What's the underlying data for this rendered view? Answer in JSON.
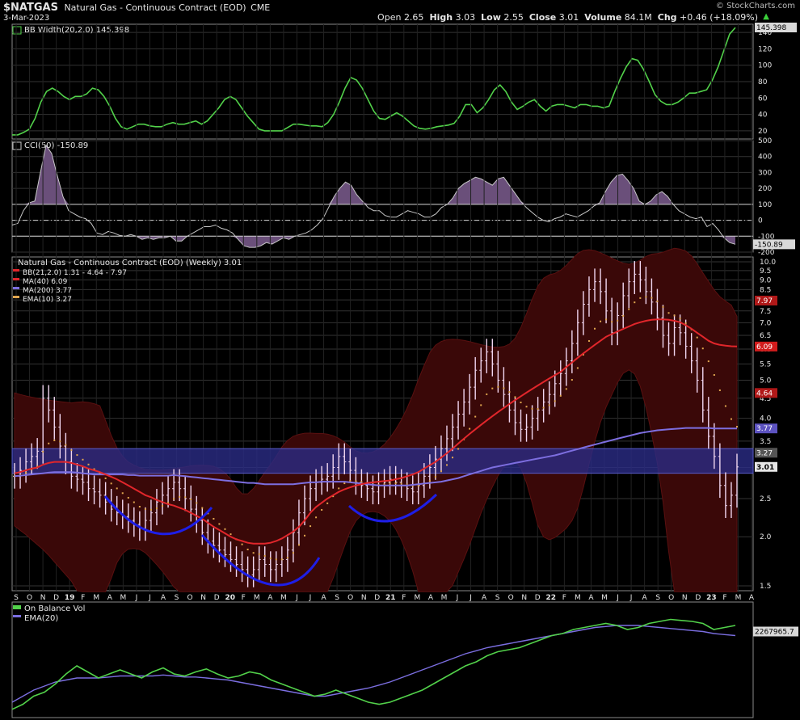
{
  "header": {
    "symbol": "$NATGAS",
    "description": "Natural Gas - Continuous Contract (EOD)",
    "exchange": "CME",
    "date": "3-Mar-2023",
    "watermark": "© StockCharts.com",
    "open_label": "Open",
    "open": "2.65",
    "high_label": "High",
    "high": "3.03",
    "low_label": "Low",
    "low": "2.55",
    "close_label": "Close",
    "close": "3.01",
    "volume_label": "Volume",
    "volume": "84.1M",
    "chg_label": "Chg",
    "chg": "+0.46 (+18.09%)"
  },
  "colors": {
    "background": "#000000",
    "grid": "#333333",
    "bbwidth": "#52d14a",
    "cci_fill": "#6a4f7a",
    "ma40": "#e1262b",
    "ma200": "#7d6ee0",
    "ema10": "#e0a64f",
    "candle": "#f1d6f0",
    "bb_fill": "#3a0808",
    "support_band": "#2a2c86",
    "obv": "#52d14a",
    "obv_ema": "#7b6ee0",
    "pattern_arc": "#1e1ee6"
  },
  "chart_data": [
    {
      "type": "line",
      "panel": "BB Width",
      "title": "BB Width(20,2.0) 145.398",
      "last_value_label": "145.398",
      "y_ticks": [
        "20",
        "40",
        "60",
        "80",
        "100",
        "120",
        "140"
      ],
      "ylim": [
        10,
        150
      ],
      "series": [
        {
          "name": "BB Width(20,2.0)",
          "values": [
            15,
            15,
            18,
            22,
            35,
            55,
            68,
            72,
            68,
            62,
            58,
            62,
            62,
            65,
            72,
            70,
            62,
            50,
            35,
            25,
            22,
            25,
            28,
            28,
            26,
            25,
            25,
            28,
            30,
            28,
            28,
            30,
            32,
            28,
            32,
            40,
            48,
            58,
            62,
            58,
            48,
            38,
            30,
            22,
            20,
            20,
            20,
            20,
            24,
            28,
            28,
            27,
            26,
            26,
            25,
            30,
            40,
            55,
            72,
            85,
            82,
            72,
            58,
            44,
            35,
            34,
            38,
            42,
            38,
            32,
            26,
            23,
            22,
            23,
            25,
            26,
            27,
            29,
            38,
            52,
            52,
            42,
            48,
            58,
            70,
            76,
            68,
            55,
            46,
            50,
            55,
            58,
            50,
            44,
            50,
            52,
            52,
            50,
            48,
            52,
            52,
            50,
            50,
            48,
            50,
            68,
            84,
            98,
            108,
            106,
            95,
            80,
            64,
            56,
            52,
            52,
            55,
            60,
            66,
            66,
            68,
            70,
            82,
            98,
            118,
            138,
            146
          ]
        }
      ]
    },
    {
      "type": "area",
      "panel": "CCI",
      "title": "CCI(50) -150.89",
      "last_value_label": "-150.89",
      "y_ticks": [
        "500",
        "400",
        "300",
        "200",
        "100",
        "0",
        "-100",
        "-200"
      ],
      "ylim": [
        -200,
        500
      ],
      "series": [
        {
          "name": "CCI(50)",
          "values": [
            -30,
            -20,
            60,
            110,
            120,
            300,
            470,
            420,
            280,
            150,
            60,
            40,
            20,
            10,
            -20,
            -80,
            -90,
            -70,
            -80,
            -95,
            -100,
            -90,
            -100,
            -120,
            -110,
            -120,
            -110,
            -110,
            -100,
            -130,
            -130,
            -100,
            -80,
            -60,
            -40,
            -40,
            -30,
            -50,
            -60,
            -80,
            -120,
            -160,
            -170,
            -170,
            -160,
            -140,
            -150,
            -130,
            -110,
            -120,
            -100,
            -90,
            -80,
            -60,
            -30,
            10,
            80,
            150,
            200,
            240,
            220,
            160,
            120,
            80,
            60,
            60,
            30,
            20,
            20,
            40,
            60,
            50,
            40,
            20,
            20,
            40,
            80,
            100,
            140,
            200,
            230,
            250,
            270,
            260,
            240,
            220,
            260,
            270,
            220,
            170,
            120,
            80,
            50,
            20,
            0,
            -10,
            10,
            20,
            40,
            30,
            20,
            40,
            60,
            90,
            110,
            180,
            240,
            280,
            290,
            250,
            200,
            120,
            100,
            120,
            160,
            180,
            150,
            100,
            60,
            40,
            20,
            10,
            20,
            -40,
            -20,
            -60,
            -110,
            -140,
            -151
          ]
        }
      ]
    },
    {
      "type": "line",
      "panel": "Price",
      "title": "Natural Gas - Continuous Contract (EOD) (Weekly) 3.01",
      "legend": [
        {
          "name": "BB(21,2.0) 1.31 - 4.64 - 7.97"
        },
        {
          "name": "MA(40) 6.09"
        },
        {
          "name": "MA(200) 3.77"
        },
        {
          "name": "EMA(10) 3.27"
        }
      ],
      "y_ticks": [
        "1.5",
        "2.0",
        "2.5",
        "3.0",
        "3.5",
        "4.0",
        "4.5",
        "5.0",
        "5.5",
        "6.0",
        "6.5",
        "7.0",
        "7.5",
        "8.0",
        "8.5",
        "9.0",
        "9.5",
        "10.0"
      ],
      "ylim": [
        1.5,
        10.0
      ],
      "value_labels": [
        "7.97",
        "6.09",
        "4.64",
        "3.77",
        "3.27",
        "3.01"
      ],
      "x_ticks": [
        "S",
        "O",
        "N",
        "D",
        "19",
        "F",
        "M",
        "A",
        "M",
        "J",
        "J",
        "A",
        "S",
        "O",
        "N",
        "D",
        "20",
        "F",
        "M",
        "A",
        "M",
        "J",
        "J",
        "A",
        "S",
        "O",
        "N",
        "D",
        "21",
        "F",
        "M",
        "A",
        "M",
        "J",
        "J",
        "A",
        "S",
        "O",
        "N",
        "D",
        "22",
        "F",
        "M",
        "A",
        "M",
        "J",
        "J",
        "A",
        "S",
        "O",
        "N",
        "D",
        "23",
        "F",
        "M",
        "A"
      ],
      "close": [
        2.85,
        2.95,
        3.1,
        3.2,
        3.3,
        4.5,
        4.2,
        3.8,
        3.4,
        3.1,
        2.85,
        2.8,
        2.75,
        2.65,
        2.6,
        2.55,
        2.45,
        2.35,
        2.3,
        2.25,
        2.2,
        2.15,
        2.1,
        2.2,
        2.3,
        2.45,
        2.55,
        2.65,
        2.75,
        2.65,
        2.5,
        2.35,
        2.2,
        2.05,
        1.95,
        1.9,
        1.85,
        1.8,
        1.75,
        1.7,
        1.65,
        1.6,
        1.65,
        1.75,
        1.7,
        1.65,
        1.7,
        1.75,
        1.85,
        2.05,
        2.3,
        2.5,
        2.65,
        2.75,
        2.8,
        2.85,
        3.0,
        3.2,
        3.1,
        2.95,
        2.75,
        2.7,
        2.65,
        2.6,
        2.7,
        2.75,
        2.8,
        2.75,
        2.7,
        2.65,
        2.6,
        2.7,
        2.85,
        3.0,
        3.15,
        3.35,
        3.55,
        3.8,
        4.1,
        4.4,
        4.8,
        5.3,
        5.6,
        5.9,
        5.5,
        5.0,
        4.6,
        4.2,
        3.9,
        3.75,
        3.8,
        4.0,
        4.2,
        4.4,
        4.6,
        4.9,
        5.2,
        5.6,
        6.2,
        7.0,
        7.8,
        8.5,
        8.9,
        8.4,
        7.5,
        6.6,
        7.3,
        8.2,
        8.9,
        9.3,
        9.0,
        8.4,
        7.9,
        7.2,
        6.5,
        6.2,
        6.8,
        6.6,
        6.1,
        5.6,
        5.0,
        4.2,
        3.6,
        3.2,
        2.7,
        2.4,
        2.55,
        3.01
      ],
      "ma40": [
        2.9,
        2.92,
        2.95,
        2.98,
        3.0,
        3.05,
        3.08,
        3.1,
        3.1,
        3.1,
        3.08,
        3.05,
        3.02,
        2.98,
        2.95,
        2.92,
        2.88,
        2.84,
        2.8,
        2.75,
        2.7,
        2.65,
        2.6,
        2.55,
        2.52,
        2.48,
        2.45,
        2.42,
        2.4,
        2.37,
        2.34,
        2.3,
        2.26,
        2.22,
        2.17,
        2.12,
        2.08,
        2.04,
        2.0,
        1.97,
        1.95,
        1.93,
        1.92,
        1.92,
        1.92,
        1.93,
        1.95,
        1.98,
        2.02,
        2.06,
        2.12,
        2.2,
        2.3,
        2.38,
        2.44,
        2.5,
        2.55,
        2.6,
        2.64,
        2.67,
        2.7,
        2.72,
        2.74,
        2.75,
        2.76,
        2.77,
        2.78,
        2.8,
        2.82,
        2.85,
        2.88,
        2.92,
        2.98,
        3.04,
        3.1,
        3.18,
        3.26,
        3.35,
        3.45,
        3.55,
        3.65,
        3.75,
        3.85,
        3.95,
        4.05,
        4.15,
        4.25,
        4.35,
        4.45,
        4.55,
        4.65,
        4.75,
        4.85,
        4.95,
        5.05,
        5.15,
        5.25,
        5.4,
        5.55,
        5.7,
        5.85,
        6.0,
        6.15,
        6.3,
        6.45,
        6.55,
        6.65,
        6.75,
        6.85,
        6.95,
        7.02,
        7.08,
        7.12,
        7.14,
        7.14,
        7.12,
        7.08,
        7.02,
        6.9,
        6.76,
        6.6,
        6.45,
        6.3,
        6.2,
        6.15,
        6.12,
        6.1,
        6.09
      ],
      "ma200": [
        2.85,
        2.86,
        2.87,
        2.88,
        2.89,
        2.9,
        2.91,
        2.92,
        2.92,
        2.92,
        2.92,
        2.91,
        2.9,
        2.89,
        2.88,
        2.88,
        2.88,
        2.88,
        2.88,
        2.88,
        2.87,
        2.87,
        2.86,
        2.86,
        2.86,
        2.86,
        2.86,
        2.86,
        2.87,
        2.86,
        2.85,
        2.84,
        2.83,
        2.82,
        2.81,
        2.8,
        2.79,
        2.78,
        2.77,
        2.76,
        2.75,
        2.74,
        2.74,
        2.73,
        2.72,
        2.72,
        2.72,
        2.72,
        2.72,
        2.72,
        2.73,
        2.74,
        2.75,
        2.75,
        2.76,
        2.76,
        2.76,
        2.76,
        2.76,
        2.75,
        2.74,
        2.73,
        2.72,
        2.71,
        2.7,
        2.7,
        2.7,
        2.7,
        2.7,
        2.7,
        2.71,
        2.72,
        2.73,
        2.74,
        2.75,
        2.76,
        2.78,
        2.8,
        2.82,
        2.85,
        2.88,
        2.91,
        2.94,
        2.97,
        3.0,
        3.02,
        3.04,
        3.06,
        3.08,
        3.1,
        3.12,
        3.14,
        3.16,
        3.18,
        3.2,
        3.22,
        3.25,
        3.28,
        3.31,
        3.34,
        3.37,
        3.4,
        3.43,
        3.46,
        3.49,
        3.52,
        3.55,
        3.58,
        3.61,
        3.64,
        3.67,
        3.69,
        3.71,
        3.73,
        3.74,
        3.75,
        3.76,
        3.77,
        3.78,
        3.78,
        3.78,
        3.78,
        3.78,
        3.77,
        3.77,
        3.77,
        3.77,
        3.77
      ]
    },
    {
      "type": "line",
      "panel": "On Balance Vol",
      "title": "On Balance Vol",
      "last_value_label": "2267965.7",
      "series": [
        {
          "name": "On Balance Vol",
          "values": [
            0.05,
            0.1,
            0.18,
            0.22,
            0.3,
            0.4,
            0.48,
            0.42,
            0.36,
            0.4,
            0.44,
            0.4,
            0.36,
            0.42,
            0.46,
            0.4,
            0.38,
            0.42,
            0.45,
            0.4,
            0.36,
            0.38,
            0.42,
            0.4,
            0.34,
            0.3,
            0.26,
            0.22,
            0.18,
            0.2,
            0.24,
            0.2,
            0.16,
            0.12,
            0.1,
            0.12,
            0.16,
            0.2,
            0.24,
            0.3,
            0.36,
            0.42,
            0.48,
            0.52,
            0.58,
            0.62,
            0.64,
            0.66,
            0.7,
            0.74,
            0.78,
            0.8,
            0.84,
            0.86,
            0.88,
            0.9,
            0.88,
            0.84,
            0.86,
            0.9,
            0.92,
            0.94,
            0.93,
            0.92,
            0.9,
            0.84,
            0.86,
            0.88
          ]
        },
        {
          "name": "EMA(20)",
          "values": [
            0.12,
            0.18,
            0.24,
            0.28,
            0.32,
            0.34,
            0.36,
            0.36,
            0.36,
            0.37,
            0.38,
            0.38,
            0.38,
            0.38,
            0.39,
            0.38,
            0.37,
            0.37,
            0.36,
            0.35,
            0.34,
            0.32,
            0.3,
            0.28,
            0.26,
            0.24,
            0.22,
            0.2,
            0.18,
            0.18,
            0.2,
            0.22,
            0.24,
            0.26,
            0.29,
            0.32,
            0.36,
            0.4,
            0.44,
            0.48,
            0.52,
            0.56,
            0.6,
            0.63,
            0.66,
            0.68,
            0.7,
            0.72,
            0.74,
            0.76,
            0.78,
            0.8,
            0.82,
            0.84,
            0.86,
            0.87,
            0.88,
            0.88,
            0.88,
            0.87,
            0.86,
            0.85,
            0.84,
            0.83,
            0.82,
            0.8,
            0.79,
            0.78
          ]
        }
      ]
    }
  ]
}
